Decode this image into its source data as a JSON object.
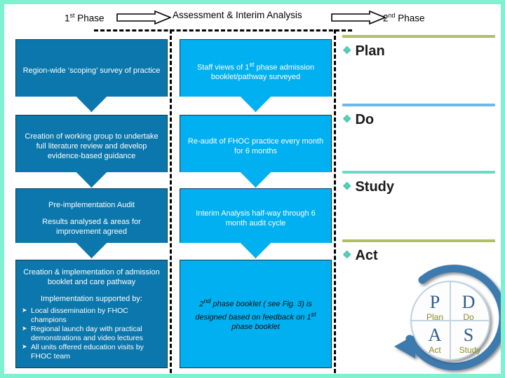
{
  "slide": {
    "border_color": "#7FF0D0",
    "background": "#ffffff"
  },
  "header": {
    "phase1": "1st Phase",
    "phase1_base": "1",
    "phase1_sup": "st",
    "phase1_rest": " Phase",
    "assessment": "Assessment & Interim Analysis",
    "phase2_base": "2",
    "phase2_sup": "nd",
    "phase2_rest": " Phase",
    "arrow1": "right-block-arrow",
    "arrow2": "right-block-arrow"
  },
  "columns": {
    "left": {
      "color": "#0B77AC",
      "steps": [
        {
          "text": "Region-wide ‘scoping’ survey of practice"
        },
        {
          "text": "Creation of working group to undertake full literature review and develop evidence-based guidance"
        },
        {
          "title": "Pre-implementation Audit",
          "sub": "Results analysed & areas for improvement agreed"
        },
        {
          "title": "Creation & implementation of admission booklet and care pathway",
          "sub": "Implementation supported by:",
          "bullets": [
            "Local dissemination by FHOC champions",
            "Regional launch day with practical demonstrations and video lectures",
            "All units offered education visits by FHOC team"
          ]
        }
      ]
    },
    "middle": {
      "color": "#00B0F0",
      "steps": [
        {
          "text": "Staff views of 1st phase admission booklet/pathway surveyed",
          "text_pre": "Staff views of 1",
          "text_sup": "st",
          "text_post": " phase admission booklet/pathway surveyed"
        },
        {
          "text": "Re-audit of FHOC practice every month for 6 months"
        },
        {
          "text": "Interim Analysis half-way through 6 month audit cycle"
        },
        {
          "text": "2nd phase booklet ( see Fig. 3) is designed based on feedback on 1st phase booklet",
          "text_pre": "2",
          "text_sup1": "nd",
          "text_mid": " phase booklet ( see Fig. 3) is designed based on feedback on 1",
          "text_sup2": "st",
          "text_post": " phase booklet"
        }
      ]
    }
  },
  "pdsa_panel": {
    "sections": [
      {
        "label": "Plan",
        "rule_color": "#AFBF62",
        "bullet": "diamond-bullet-icon"
      },
      {
        "label": "Do",
        "rule_color": "#6EB8E8",
        "bullet": "diamond-bullet-icon"
      },
      {
        "label": "Study",
        "rule_color": "#6ED7CB",
        "bullet": "diamond-bullet-icon"
      },
      {
        "label": "Act",
        "rule_color": "#AFBF62",
        "bullet": "diamond-bullet-icon"
      }
    ]
  },
  "pdsa_wheel": {
    "name": "pdsa-cycle-diagram",
    "quadrants": [
      {
        "letter": "P",
        "word": "Plan"
      },
      {
        "letter": "D",
        "word": "Do"
      },
      {
        "letter": "A",
        "word": "Act"
      },
      {
        "letter": "S",
        "word": "Study"
      }
    ],
    "letter_color": "#2E5C8A",
    "word_color": "#8A8A23",
    "ring_color": "#3E7AAE"
  }
}
